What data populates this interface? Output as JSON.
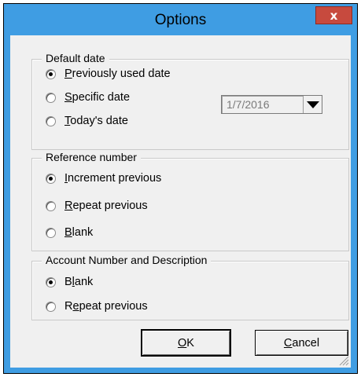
{
  "dialog": {
    "title": "Options",
    "close_label": "x"
  },
  "default_date": {
    "label": "Default date",
    "options": [
      {
        "prefix": "",
        "mnemonic": "P",
        "rest": "reviously used date",
        "checked": true
      },
      {
        "prefix": "",
        "mnemonic": "S",
        "rest": "pecific date",
        "checked": false
      },
      {
        "prefix": "",
        "mnemonic": "T",
        "rest": "oday's date",
        "checked": false
      }
    ],
    "date_value": "1/7/2016"
  },
  "reference_number": {
    "label": "Reference number",
    "options": [
      {
        "prefix": "",
        "mnemonic": "I",
        "rest": "ncrement previous",
        "checked": true
      },
      {
        "prefix": "",
        "mnemonic": "R",
        "rest": "epeat previous",
        "checked": false
      },
      {
        "prefix": "",
        "mnemonic": "B",
        "rest": "lank",
        "checked": false
      }
    ]
  },
  "account_number": {
    "label": "Account Number and Description",
    "options": [
      {
        "prefix": "B",
        "mnemonic": "l",
        "rest": "ank",
        "checked": true
      },
      {
        "prefix": "R",
        "mnemonic": "e",
        "rest": "peat previous",
        "checked": false
      }
    ]
  },
  "buttons": {
    "ok": {
      "mnemonic": "O",
      "rest": "K"
    },
    "cancel": {
      "mnemonic": "C",
      "rest": "ancel"
    }
  }
}
